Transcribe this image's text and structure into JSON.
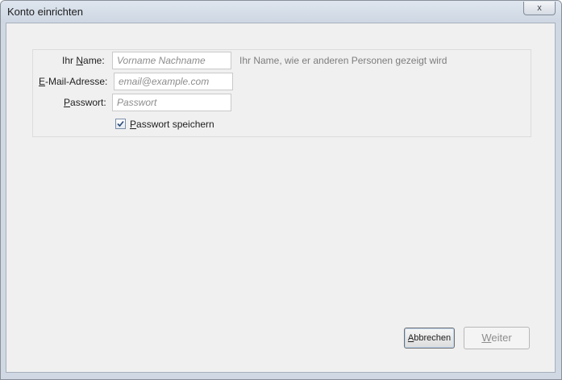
{
  "window": {
    "title": "Konto einrichten",
    "close_label": "x"
  },
  "form": {
    "name_label_pre": "Ihr ",
    "name_label_key": "N",
    "name_label_post": "ame:",
    "name_placeholder": "Vorname Nachname",
    "name_hint": "Ihr Name, wie er anderen Personen gezeigt wird",
    "email_label_key": "E",
    "email_label_post": "-Mail-Adresse:",
    "email_placeholder": "email@example.com",
    "password_label_key": "P",
    "password_label_post": "asswort:",
    "password_placeholder": "Passwort",
    "remember_label_key": "P",
    "remember_label_post": "asswort speichern",
    "remember_checked": true
  },
  "buttons": {
    "cancel_key": "A",
    "cancel_post": "bbrechen",
    "next_key": "W",
    "next_post": "eiter"
  },
  "colors": {
    "title_bar": "#cdd6e2",
    "dialog_bg": "#f0f0f0",
    "hint_text": "#7d7d7d",
    "placeholder_text": "#8d8d8d",
    "disabled_text": "#8d8d8d"
  }
}
